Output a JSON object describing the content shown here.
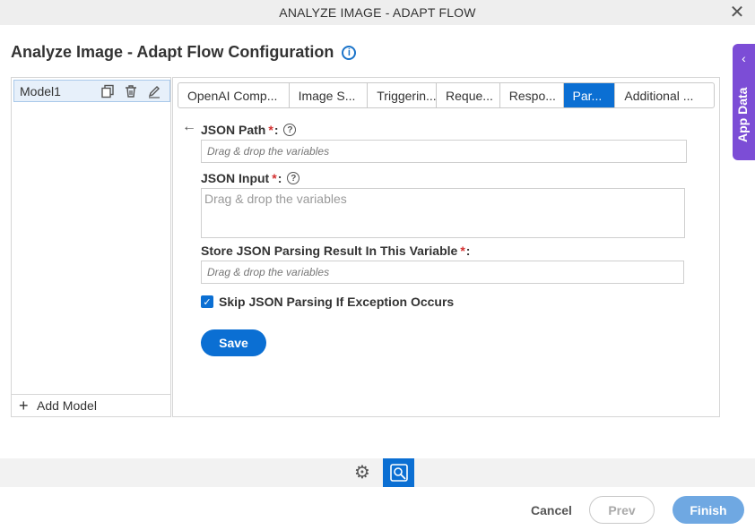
{
  "window": {
    "title": "ANALYZE IMAGE - ADAPT FLOW"
  },
  "page": {
    "title": "Analyze Image - Adapt Flow Configuration"
  },
  "side_tab": {
    "label": "App Data"
  },
  "models": {
    "items": [
      {
        "name": "Model1"
      }
    ],
    "add_label": "Add Model"
  },
  "tabs": [
    {
      "label": "OpenAI Comp..."
    },
    {
      "label": "Image S..."
    },
    {
      "label": "Triggerin..."
    },
    {
      "label": "Reque..."
    },
    {
      "label": "Respo..."
    },
    {
      "label": "Par..."
    },
    {
      "label": "Additional ..."
    }
  ],
  "form": {
    "json_path": {
      "label": "JSON Path",
      "required_mark": "*",
      "colon": ":",
      "placeholder": "Drag & drop the variables"
    },
    "json_input": {
      "label": "JSON Input",
      "required_mark": "*",
      "colon": ":",
      "placeholder": "Drag & drop the variables"
    },
    "store_result": {
      "label": "Store JSON Parsing Result In This Variable",
      "required_mark": "*",
      "colon": ":",
      "placeholder": "Drag & drop the variables"
    },
    "skip_exception": {
      "label": "Skip JSON Parsing If Exception Occurs",
      "checked": true
    },
    "save_label": "Save"
  },
  "footer": {
    "cancel_label": "Cancel",
    "prev_label": "Prev",
    "finish_label": "Finish"
  },
  "colors": {
    "accent": "#0b6fd3",
    "side_tab": "#7c4dd6",
    "required": "#d32f2f"
  }
}
